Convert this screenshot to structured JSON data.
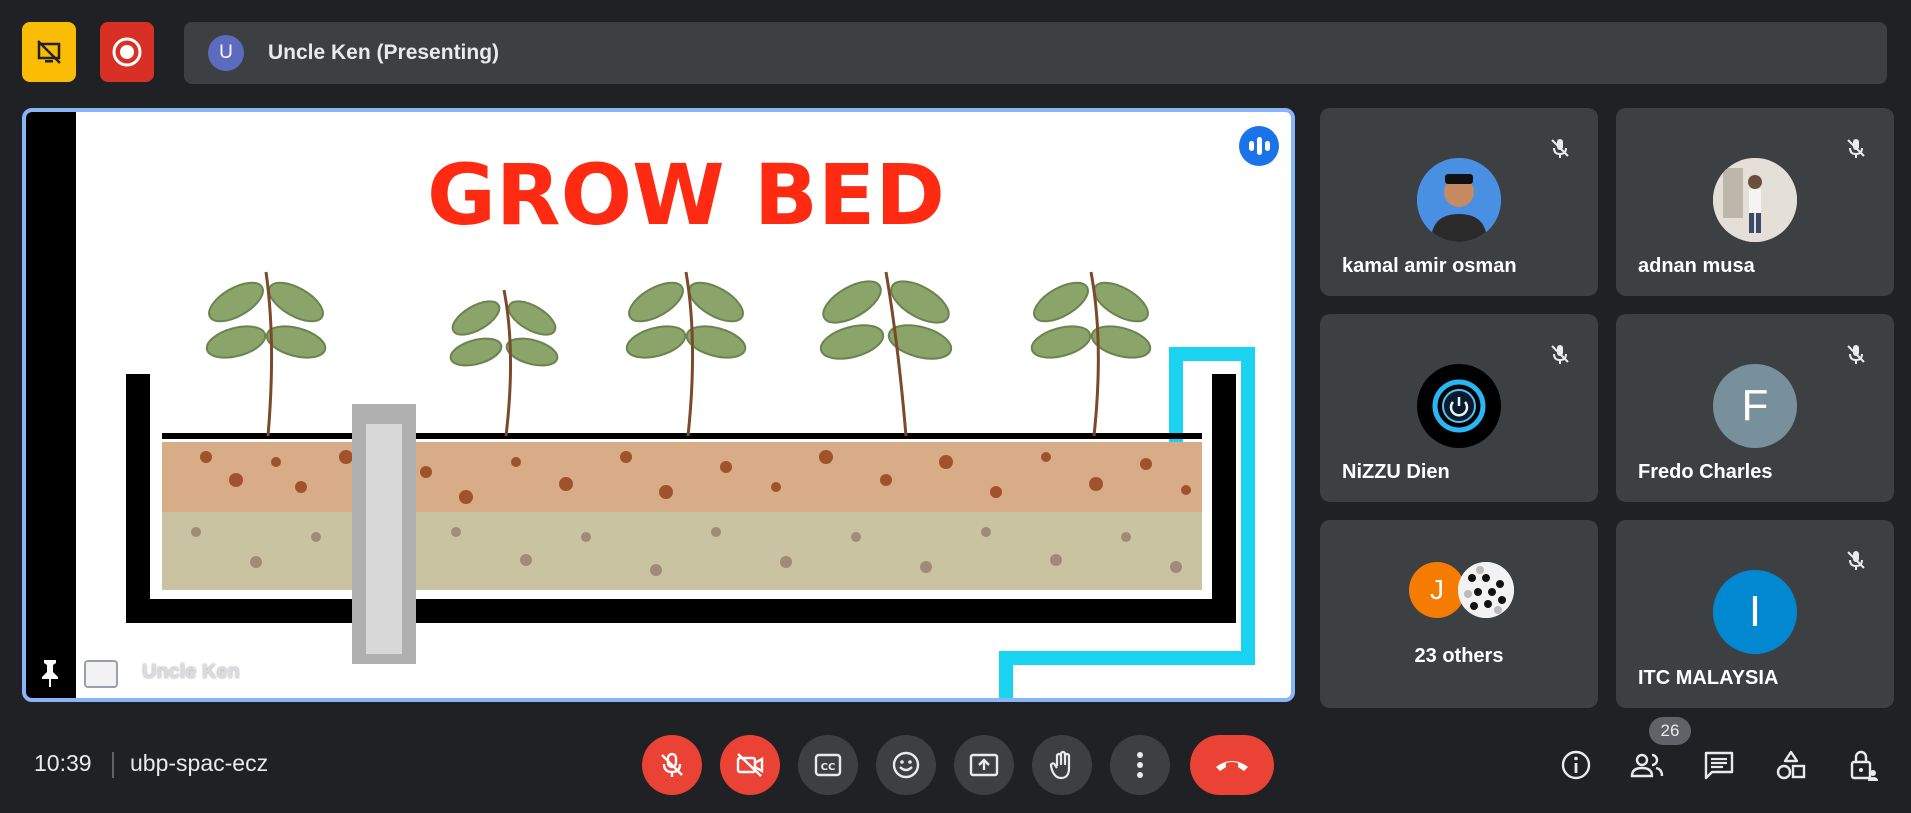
{
  "presenter_bar": {
    "avatar_letter": "U",
    "label": "Uncle Ken (Presenting)"
  },
  "main": {
    "slide_title": "GROW BED",
    "name": "Uncle Ken"
  },
  "participants": [
    {
      "name": "kamal amir osman",
      "avatar": "photo",
      "muted": true
    },
    {
      "name": "adnan musa",
      "avatar": "photo",
      "muted": true
    },
    {
      "name": "NiZZU Dien",
      "avatar": "power-logo",
      "muted": true
    },
    {
      "name": "Fredo Charles",
      "avatar_letter": "F",
      "avatar_color": "#78909c",
      "muted": true
    },
    {
      "name": "23 others",
      "avatar_letter": "J",
      "avatar_color": "#f57c00",
      "muted": false
    },
    {
      "name": "ITC MALAYSIA",
      "avatar_letter": "I",
      "avatar_color": "#0288d1",
      "muted": true
    }
  ],
  "footer": {
    "time": "10:39",
    "meeting_code": "ubp-spac-ecz",
    "people_count": "26"
  },
  "colors": {
    "background": "#202124",
    "tile": "#3c4043",
    "danger": "#ea4335",
    "accent": "#8ab4f8",
    "warning": "#fbbc04"
  }
}
